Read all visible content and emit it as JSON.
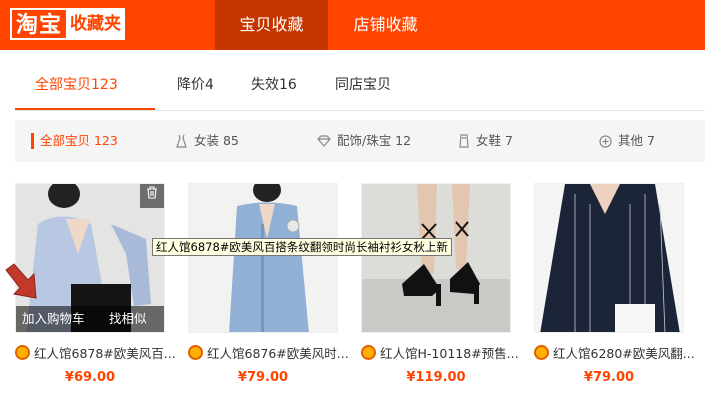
{
  "header": {
    "logo_main": "淘宝",
    "logo_sub": "收藏夹",
    "nav": [
      {
        "label": "宝贝收藏"
      },
      {
        "label": "店铺收藏"
      }
    ]
  },
  "filters": {
    "tabs": [
      {
        "label": "全部宝贝123"
      },
      {
        "label": "降价4"
      },
      {
        "label": "失效16"
      },
      {
        "label": "同店宝贝"
      }
    ]
  },
  "categories": [
    {
      "label": "全部宝贝 123",
      "icon": "active-marker"
    },
    {
      "label": "女装 85",
      "icon": "dress-icon"
    },
    {
      "label": "配饰/珠宝 12",
      "icon": "diamond-icon"
    },
    {
      "label": "女鞋 7",
      "icon": "shoe-icon"
    },
    {
      "label": "其他 7",
      "icon": "plus-circle-icon"
    }
  ],
  "products": [
    {
      "title": "红人馆6878#欧美风百...",
      "price": "¥69.00",
      "add_to_cart": "加入购物车",
      "find_similar": "找相似"
    },
    {
      "title": "红人馆6876#欧美风时...",
      "price": "¥79.00"
    },
    {
      "title": "红人馆H-10118#预售...",
      "price": "¥119.00"
    },
    {
      "title": "红人馆6280#欧美风翻...",
      "price": "¥79.00"
    }
  ],
  "tooltip": "红人馆6878#欧美风百搭条纹翻领时尚长袖衬衫女秋上新",
  "colors": {
    "brand": "#ff4400",
    "brand_dark": "#c43500"
  }
}
